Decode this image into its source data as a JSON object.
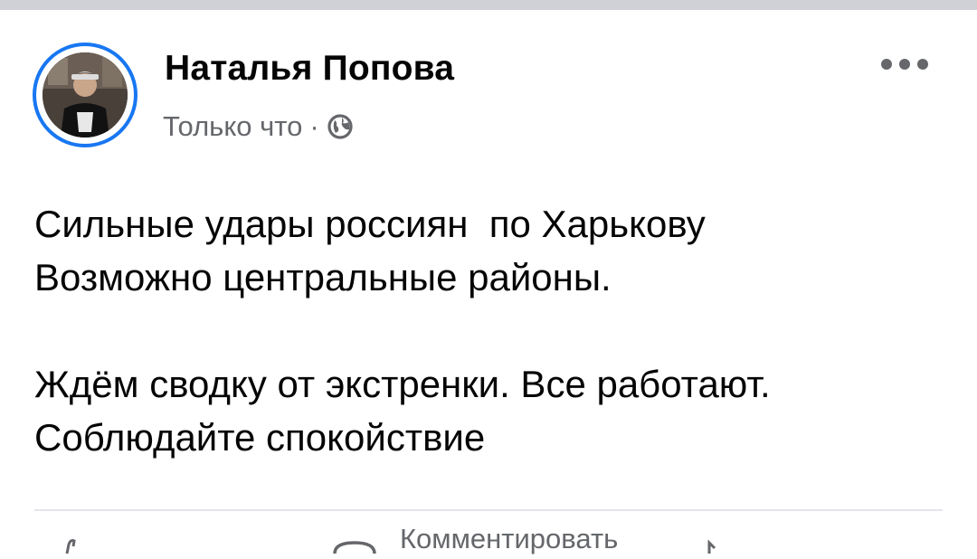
{
  "post": {
    "author": "Наталья Попова",
    "timestamp": "Только что",
    "separator": "·",
    "audience_icon": "globe-icon",
    "more_icon": "more-dots-icon",
    "text_lines": [
      "Сильные удары россиян  по Харькову",
      "Возможно центральные районы.",
      "",
      "Ждём сводку от экстренки. Все работают.",
      "Соблюдайте спокойствие"
    ]
  },
  "actions": {
    "comment_label": "Комментировать"
  },
  "colors": {
    "accent": "#1877f2",
    "text": "#050505",
    "secondary": "#65676b",
    "divider": "#e4e6eb"
  }
}
